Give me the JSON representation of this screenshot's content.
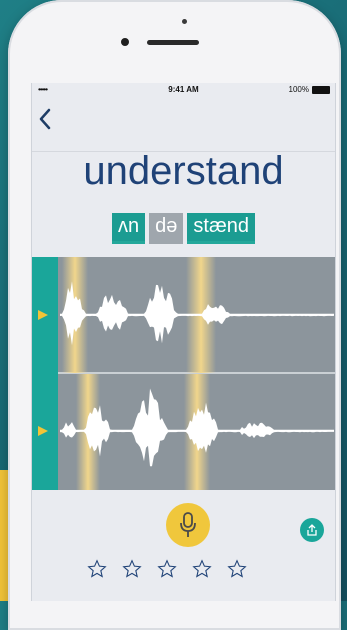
{
  "status_bar": {
    "carrier": "•••••",
    "time": "9:41 AM",
    "battery": "100%"
  },
  "nav": {
    "back_icon": "chevron-left-icon"
  },
  "word": "understand",
  "phonemes": [
    {
      "text": "ʌn",
      "state": "teal"
    },
    {
      "text": "də",
      "state": "gray"
    },
    {
      "text": "stænd",
      "state": "teal"
    }
  ],
  "waveforms": [
    {
      "name": "reference",
      "play_icon": "play-icon"
    },
    {
      "name": "recording",
      "play_icon": "play-icon"
    }
  ],
  "controls": {
    "mic_icon": "microphone-icon",
    "share_icon": "share-icon"
  },
  "rating": {
    "max": 5,
    "value": 0
  },
  "colors": {
    "teal": "#1b9c92",
    "yellow": "#f0c73c",
    "navy": "#1f4277",
    "wave_bg": "#8c959c"
  }
}
